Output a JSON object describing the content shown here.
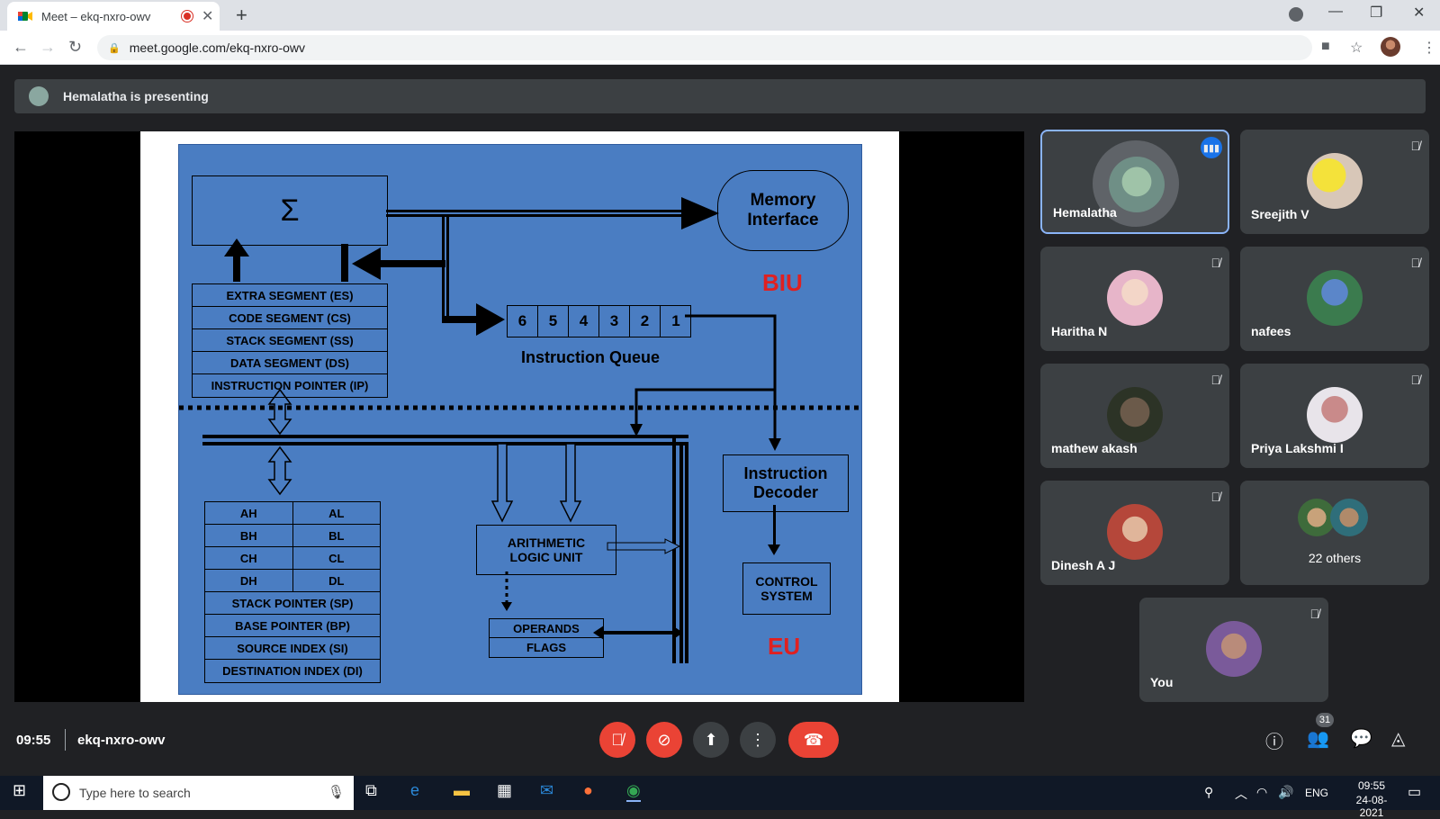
{
  "browser": {
    "tab_title": "Meet – ekq-nxro-owv",
    "url": "meet.google.com/ekq-nxro-owv"
  },
  "meet": {
    "presenting_text": "Hemalatha is presenting",
    "time": "09:55",
    "meeting_code": "ekq-nxro-owv",
    "participant_count": "31",
    "participants": [
      {
        "name": "Hemalatha"
      },
      {
        "name": "Sreejith V"
      },
      {
        "name": "Haritha N"
      },
      {
        "name": "nafees"
      },
      {
        "name": "mathew akash"
      },
      {
        "name": "Priya Lakshmi I"
      },
      {
        "name": "Dinesh A J"
      },
      {
        "name": "22 others"
      },
      {
        "name": "You"
      }
    ]
  },
  "slide": {
    "sigma": "Σ",
    "memory_interface": [
      "Memory",
      "Interface"
    ],
    "biu": "BIU",
    "eu": "EU",
    "segments": [
      "EXTRA SEGMENT (ES)",
      "CODE SEGMENT (CS)",
      "STACK SEGMENT (SS)",
      "DATA SEGMENT (DS)",
      "INSTRUCTION POINTER (IP)"
    ],
    "queue": [
      "6",
      "5",
      "4",
      "3",
      "2",
      "1"
    ],
    "queue_label": "Instruction Queue",
    "decoder": [
      "Instruction",
      "Decoder"
    ],
    "control": [
      "CONTROL",
      "SYSTEM"
    ],
    "alu": [
      "ARITHMETIC",
      "LOGIC UNIT"
    ],
    "operands": "OPERANDS",
    "flags": "FLAGS",
    "regs_pairs": [
      [
        "AH",
        "AL"
      ],
      [
        "BH",
        "BL"
      ],
      [
        "CH",
        "CL"
      ],
      [
        "DH",
        "DL"
      ]
    ],
    "regs_full": [
      "STACK POINTER (SP)",
      "BASE POINTER (BP)",
      "SOURCE INDEX (SI)",
      "DESTINATION INDEX (DI)"
    ]
  },
  "taskbar": {
    "search_placeholder": "Type here to search",
    "lang": "ENG",
    "clock_time": "09:55",
    "clock_date": "24-08-2021"
  }
}
